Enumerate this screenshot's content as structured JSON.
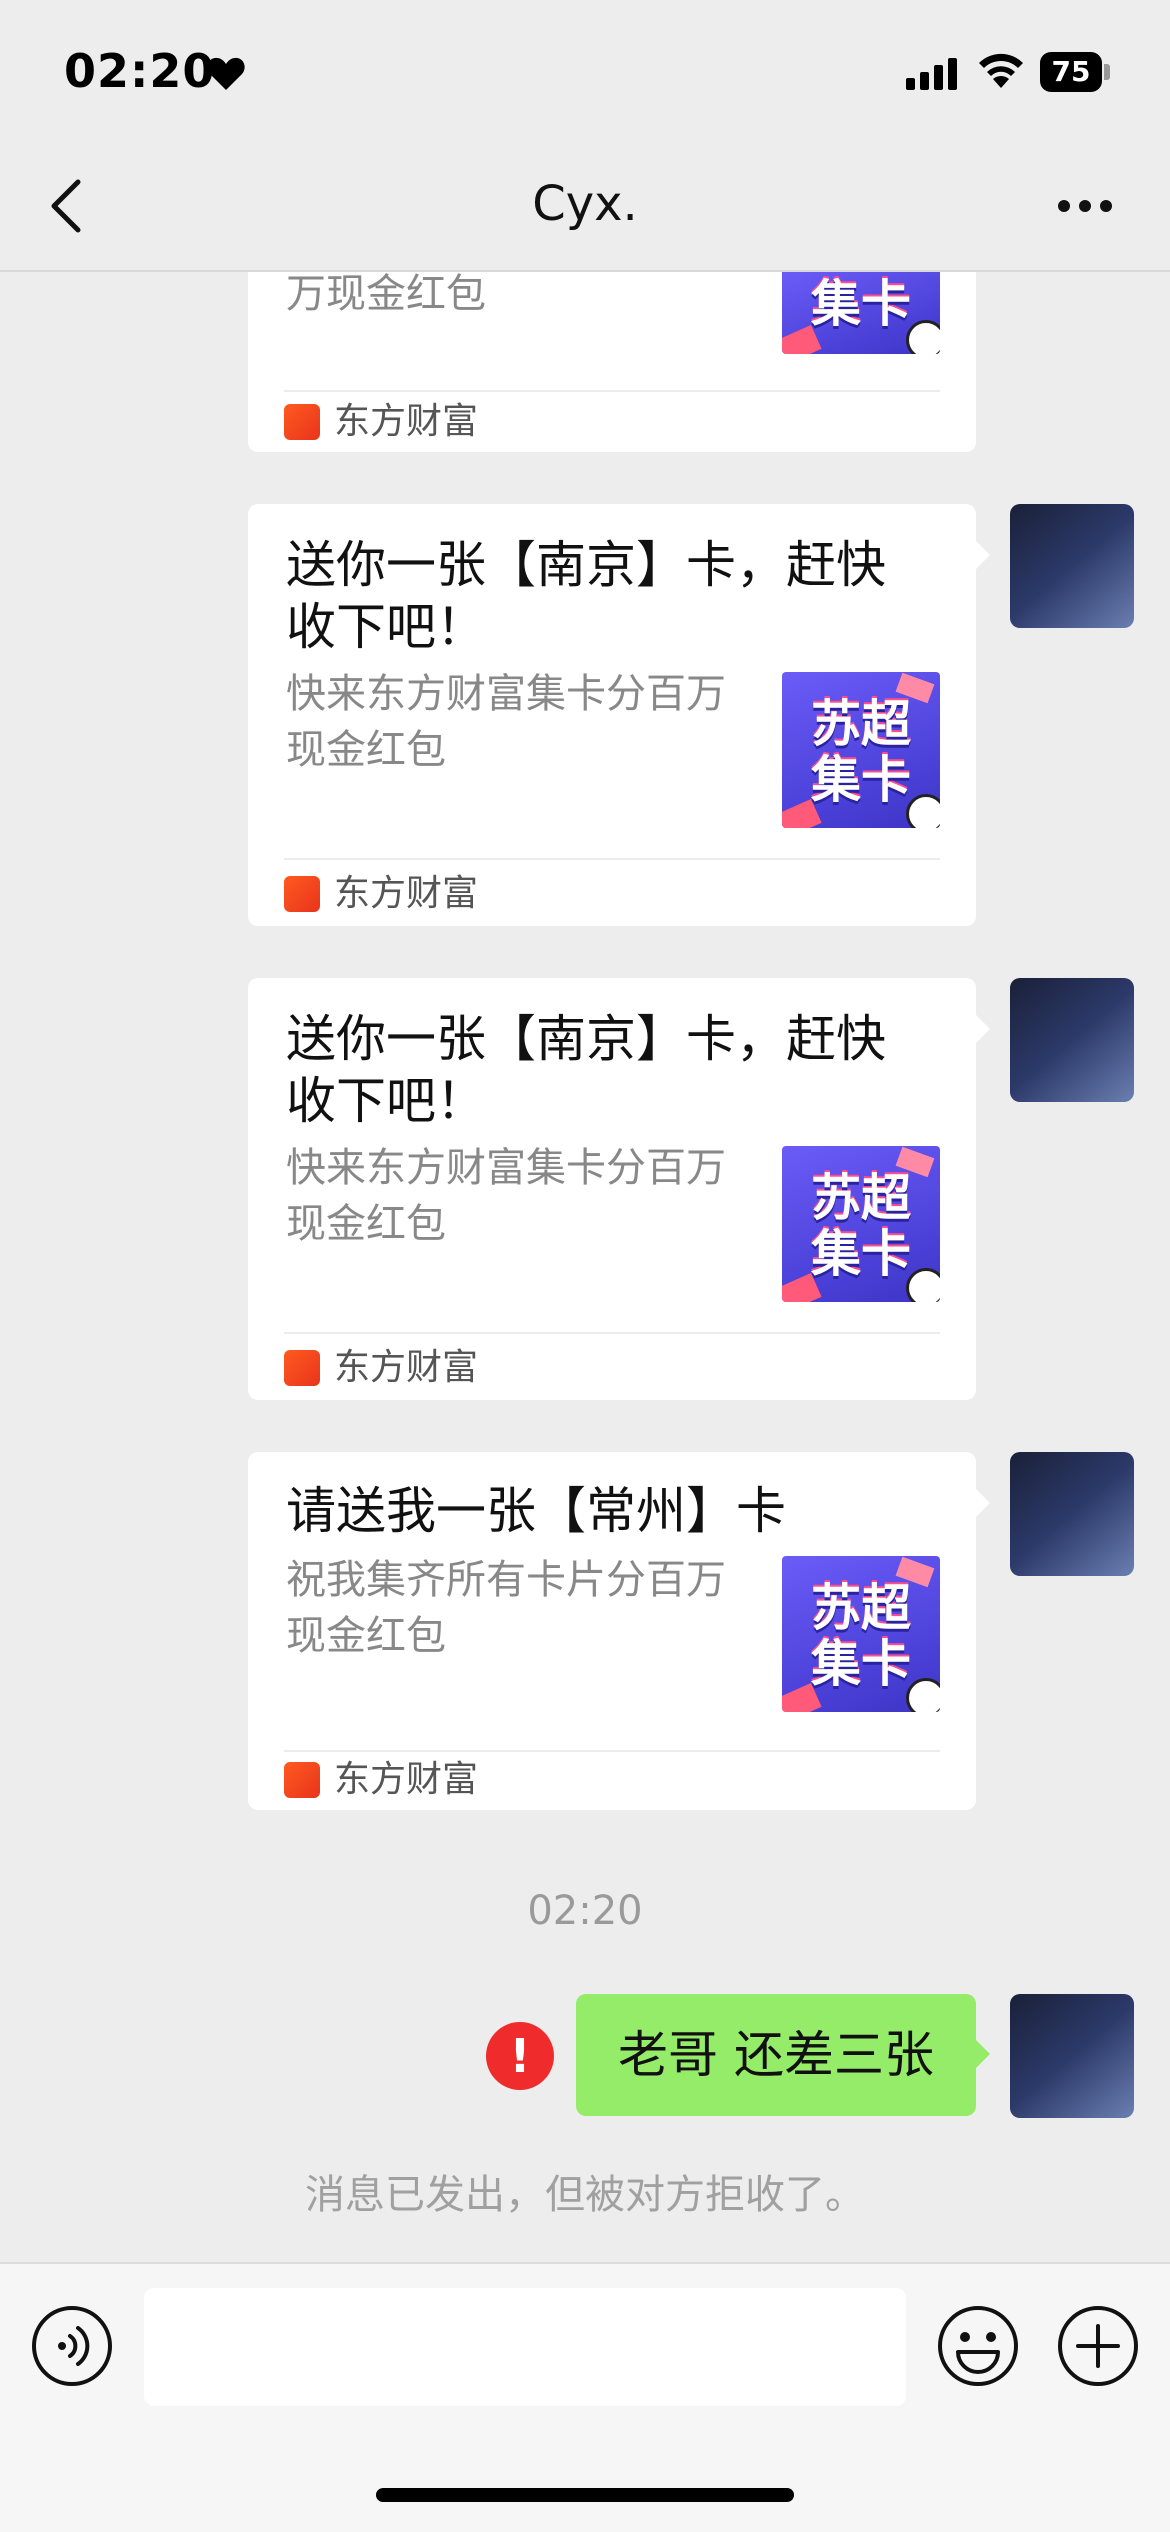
{
  "status_bar": {
    "time": "02:20",
    "battery": "75"
  },
  "nav": {
    "title": "Cyx."
  },
  "messages": [
    {
      "title": "",
      "description": "万现金红包",
      "thumb_text": "集卡",
      "source": "东方财富"
    },
    {
      "title": "送你一张【南京】卡，赶快收下吧！",
      "description": "快来东方财富集卡分百万现金红包",
      "thumb_text": "苏超\n集卡",
      "source": "东方财富"
    },
    {
      "title": "送你一张【南京】卡，赶快收下吧！",
      "description": "快来东方财富集卡分百万现金红包",
      "thumb_text": "苏超\n集卡",
      "source": "东方财富"
    },
    {
      "title": "请送我一张【常州】卡",
      "description": "祝我集齐所有卡片分百万现金红包",
      "thumb_text": "苏超\n集卡",
      "source": "东方财富"
    }
  ],
  "timestamp": "02:20",
  "sent_message": {
    "text": "老哥 还差三张",
    "error_mark": "!"
  },
  "system_note": "消息已发出，但被对方拒收了。",
  "input": {
    "placeholder": ""
  },
  "colors": {
    "background": "#ededed",
    "sent_bubble": "#95ec69",
    "error": "#f02b2b",
    "card_thumb": "#5a4ff0"
  }
}
